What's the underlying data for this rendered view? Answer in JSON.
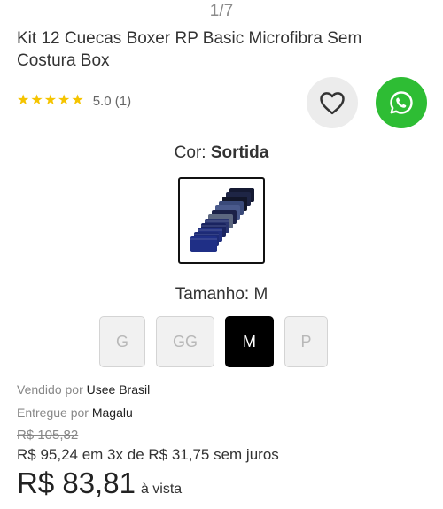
{
  "gallery": {
    "page_indicator": "1/7"
  },
  "product": {
    "title": "Kit 12 Cuecas Boxer RP Basic Microfibra Sem Costura Box",
    "rating": {
      "stars": 5,
      "score_text": "5.0 (1)"
    }
  },
  "actions": {
    "favorite_icon": "heart-icon",
    "share_icon": "whatsapp-icon"
  },
  "color": {
    "label": "Cor:",
    "selected": "Sortida",
    "swatch_icon": "boxer-stack-thumbnail"
  },
  "size": {
    "label": "Tamanho: M",
    "options": [
      {
        "label": "G",
        "state": "disabled"
      },
      {
        "label": "GG",
        "state": "disabled"
      },
      {
        "label": "M",
        "state": "selected"
      },
      {
        "label": "P",
        "state": "disabled"
      }
    ]
  },
  "seller": {
    "prefix": "Vendido por",
    "name": "Usee Brasil"
  },
  "delivery": {
    "prefix": "Entregue por",
    "name": "Magalu"
  },
  "pricing": {
    "old_price": "R$ 105,82",
    "installments": "R$ 95,24 em 3x de R$ 31,75 sem juros",
    "price": "R$ 83,81",
    "price_suffix": "à vista"
  },
  "colors": {
    "star": "#f5c400",
    "whatsapp": "#2ebd34",
    "favorite_bg": "#ececec",
    "selected_size": "#000000"
  }
}
